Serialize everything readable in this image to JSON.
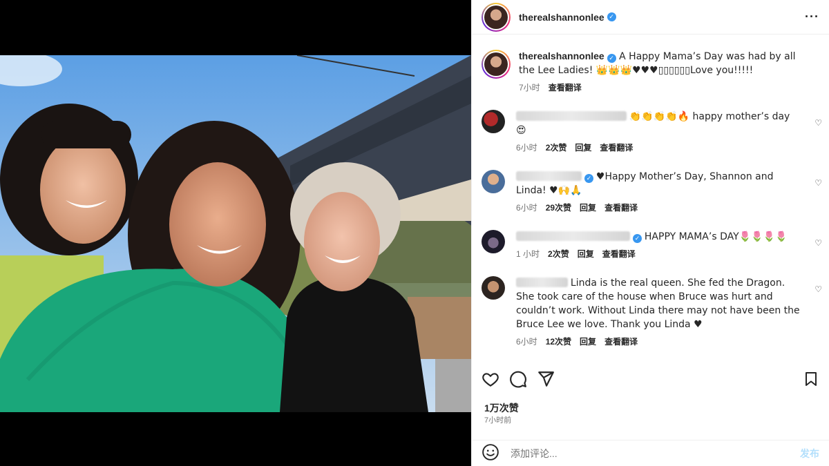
{
  "post": {
    "username": "therealshannonlee",
    "verified_mark": "✓",
    "more_glyph": "···"
  },
  "caption": {
    "username": "therealshannonlee",
    "text": " A Happy Mama’s Day was had by all the Lee Ladies! 👑👑👑♥♥♥▯▯▯▯▯▯Love you!!!!!",
    "time": "7小时",
    "translate": "查看翻译"
  },
  "comments": [
    {
      "text": "👏👏👏👏🔥 happy mother’s day 😍",
      "time": "6小时",
      "likes": "2次赞",
      "reply": "回复",
      "translate": "查看翻译"
    },
    {
      "text": "♥Happy Mother’s Day, Shannon and Linda! ♥🙌🙏",
      "time": "6小时",
      "likes": "29次赞",
      "reply": "回复",
      "translate": "查看翻译"
    },
    {
      "text": "HAPPY MAMA’s DAY🌷🌷🌷🌷",
      "time": "1 小时",
      "likes": "2次赞",
      "reply": "回复",
      "translate": "查看翻译"
    },
    {
      "text": "Linda is the real queen. She fed the Dragon. She took care of the house when Bruce was hurt and couldn’t work. Without Linda there may not have been the Bruce Lee we love. Thank you Linda ♥",
      "time": "6小时",
      "likes": "12次赞",
      "reply": "回复",
      "translate": "查看翻译"
    }
  ],
  "stats": {
    "likes": "1万次赞",
    "time": "7小时前"
  },
  "add_comment": {
    "placeholder": "添加评论...",
    "post_label": "发布"
  },
  "colors": {
    "verified": "#3897f0",
    "post_disabled": "#b2dffc",
    "muted": "#737373"
  }
}
